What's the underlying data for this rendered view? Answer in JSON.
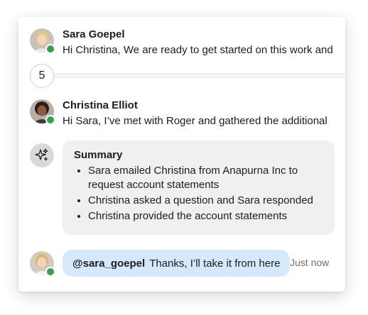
{
  "thread": {
    "message1": {
      "sender": "Sara Goepel",
      "preview": "Hi Christina, We are ready to get started on this work and",
      "avatar": "sara-goepel-avatar",
      "presence": "online"
    },
    "collapsed": {
      "count": "5"
    },
    "message2": {
      "sender": "Christina Elliot",
      "preview": "Hi Sara, I’ve met with Roger and gathered the additional",
      "avatar": "christina-elliot-avatar",
      "presence": "online"
    },
    "summary": {
      "icon": "sparkles-icon",
      "title": "Summary",
      "items": [
        "Sara emailed Christina from Anapurna Inc to request account statements",
        "Christina asked a question and Sara responded",
        "Christina provided the account statements"
      ]
    },
    "reply": {
      "mention": "@sara_goepel",
      "text": "Thanks, I’ll take it from here",
      "timestamp": "Just now",
      "avatar": "current-user-avatar",
      "presence": "online"
    }
  },
  "colors": {
    "presence_online": "#2ea44f",
    "reply_bubble": "#d6e8fb",
    "summary_bg": "#f0f0f0"
  }
}
